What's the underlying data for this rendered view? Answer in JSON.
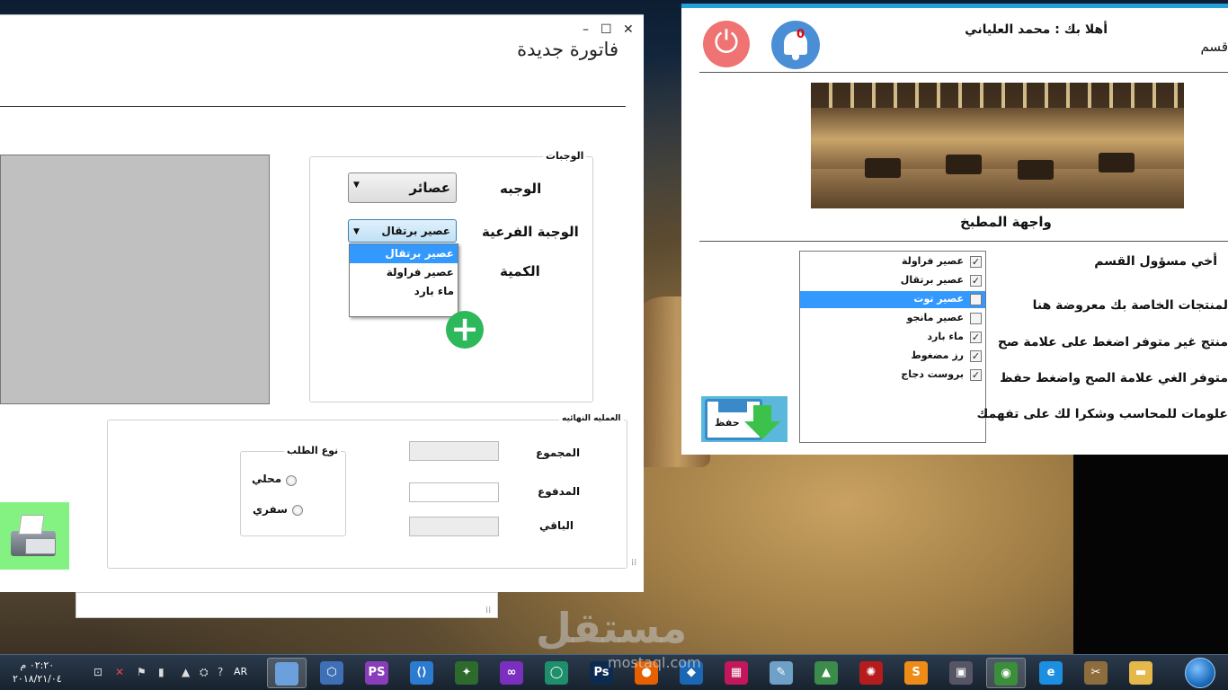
{
  "invoice_window": {
    "title": "فاتورة جديدة",
    "meals_group": {
      "legend": "الوجبات",
      "meal_label": "الوجبه",
      "meal_value": "عصائر",
      "submeal_label": "الوجبة الفرعية",
      "submeal_value": "عصير برتقال",
      "submeal_options": [
        "عصير برتقال",
        "عصير فراولة",
        "ماء بارد"
      ],
      "quantity_label": "الكمية"
    },
    "final_group": {
      "legend": "العمليه النهائيه",
      "total_label": "المجموع",
      "paid_label": "المدفوع",
      "remaining_label": "الباقي",
      "total_value": "",
      "paid_value": "",
      "remaining_value": "",
      "order_type": {
        "legend": "نوع الطلب",
        "local_label": "محلي",
        "takeaway_label": "سفري"
      }
    }
  },
  "kitchen_window": {
    "welcome": "أهلا بك : محمد العلياني",
    "dept_title": "قسم",
    "notifications_count": "0",
    "photo_caption": "واجهة المطبخ",
    "products": [
      {
        "name": "عصير فراولة",
        "checked": true,
        "selected": false
      },
      {
        "name": "عصير برتقال",
        "checked": true,
        "selected": false
      },
      {
        "name": "عصير توت",
        "checked": false,
        "selected": true
      },
      {
        "name": "عصير مانجو",
        "checked": false,
        "selected": false
      },
      {
        "name": "ماء بارد",
        "checked": true,
        "selected": false
      },
      {
        "name": "رز مضغوط",
        "checked": true,
        "selected": false
      },
      {
        "name": "بروست دجاج",
        "checked": true,
        "selected": false
      }
    ],
    "instructions": [
      "أخي مسؤول القسم",
      "لمنتجات الخاصة بك معروضة هنا",
      "منتج غير متوفر اضغط على علامة صح",
      "متوفر الغي علامة الصح واضغط حفظ",
      "علومات للمحاسب وشكرا لك على تفهمك"
    ],
    "save_label": "حفظ"
  },
  "watermark": {
    "main": "مستقل",
    "sub": "mostaql.com"
  },
  "taskbar": {
    "clock_time": "٠٢:٢٠ م",
    "clock_date": "٢٠١٨/٢١/٠٤",
    "language": "AR",
    "apps": [
      {
        "icon": "window-app-icon",
        "glyph": "",
        "color": "#6ca0dc",
        "active": true
      },
      {
        "icon": "hex-app-icon",
        "glyph": "⬡",
        "color": "#3f6fb5",
        "active": false
      },
      {
        "icon": "phpstorm-icon",
        "glyph": "PS",
        "color": "#8a3dbb",
        "active": false
      },
      {
        "icon": "vscode-icon",
        "glyph": "⟨⟩",
        "color": "#2b7bd0",
        "active": false
      },
      {
        "icon": "gecko-icon",
        "glyph": "✦",
        "color": "#2d6b2d",
        "active": false
      },
      {
        "icon": "visual-studio-icon",
        "glyph": "∞",
        "color": "#7b2fbf",
        "active": false
      },
      {
        "icon": "circle-app-icon",
        "glyph": "◯",
        "color": "#1e8f6a",
        "active": false
      },
      {
        "icon": "photoshop-icon",
        "glyph": "Ps",
        "color": "#0d2a4f",
        "active": false
      },
      {
        "icon": "firefox-icon",
        "glyph": "●",
        "color": "#e66000",
        "active": false
      },
      {
        "icon": "shield-app-icon",
        "glyph": "◆",
        "color": "#1b67b3",
        "active": false
      },
      {
        "icon": "layers-app-icon",
        "glyph": "▦",
        "color": "#c2185b",
        "active": false
      },
      {
        "icon": "paint-icon",
        "glyph": "✎",
        "color": "#6fa0c8",
        "active": false
      },
      {
        "icon": "android-studio-icon",
        "glyph": "▲",
        "color": "#3b8b4a",
        "active": false
      },
      {
        "icon": "gear-app-icon",
        "glyph": "✺",
        "color": "#b71c1c",
        "active": false
      },
      {
        "icon": "sublime-icon",
        "glyph": "S",
        "color": "#ef8c18",
        "active": false
      },
      {
        "icon": "camera-app-icon",
        "glyph": "▣",
        "color": "#556",
        "active": false
      },
      {
        "icon": "chrome-icon",
        "glyph": "◉",
        "color": "#3b8f3b",
        "active": true
      },
      {
        "icon": "ie-icon",
        "glyph": "e",
        "color": "#1d8fe0",
        "active": false
      },
      {
        "icon": "tools-app-icon",
        "glyph": "✂",
        "color": "#8c6d3b",
        "active": false
      },
      {
        "icon": "folder-icon",
        "glyph": "▬",
        "color": "#e5b84c",
        "active": false
      }
    ]
  }
}
